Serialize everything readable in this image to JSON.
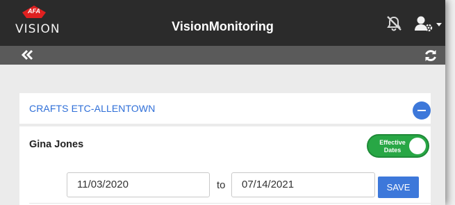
{
  "header": {
    "logo_badge": "AFA",
    "logo_text": "VISION",
    "title": "VisionMonitoring",
    "notification_icon": "notifications-off-icon",
    "user_icon": "user-settings-icon"
  },
  "subheader": {
    "back_icon": "double-chevron-left-icon",
    "refresh_icon": "refresh-icon"
  },
  "store": {
    "name": "CRAFTS ETC-ALLENTOWN",
    "collapse_icon": "minus-circle-icon"
  },
  "employee": {
    "name": "Gina Jones",
    "toggle_label": "Effective Dates",
    "toggle_on": true,
    "from_date": "11/03/2020",
    "to_label": "to",
    "to_date": "07/14/2021",
    "save_label": "SAVE"
  },
  "colors": {
    "header_bg": "#2b2b2b",
    "subheader_bg": "#5a5a5a",
    "accent_blue": "#3d78da",
    "toggle_green": "#28a745",
    "logo_red": "#e02020"
  }
}
